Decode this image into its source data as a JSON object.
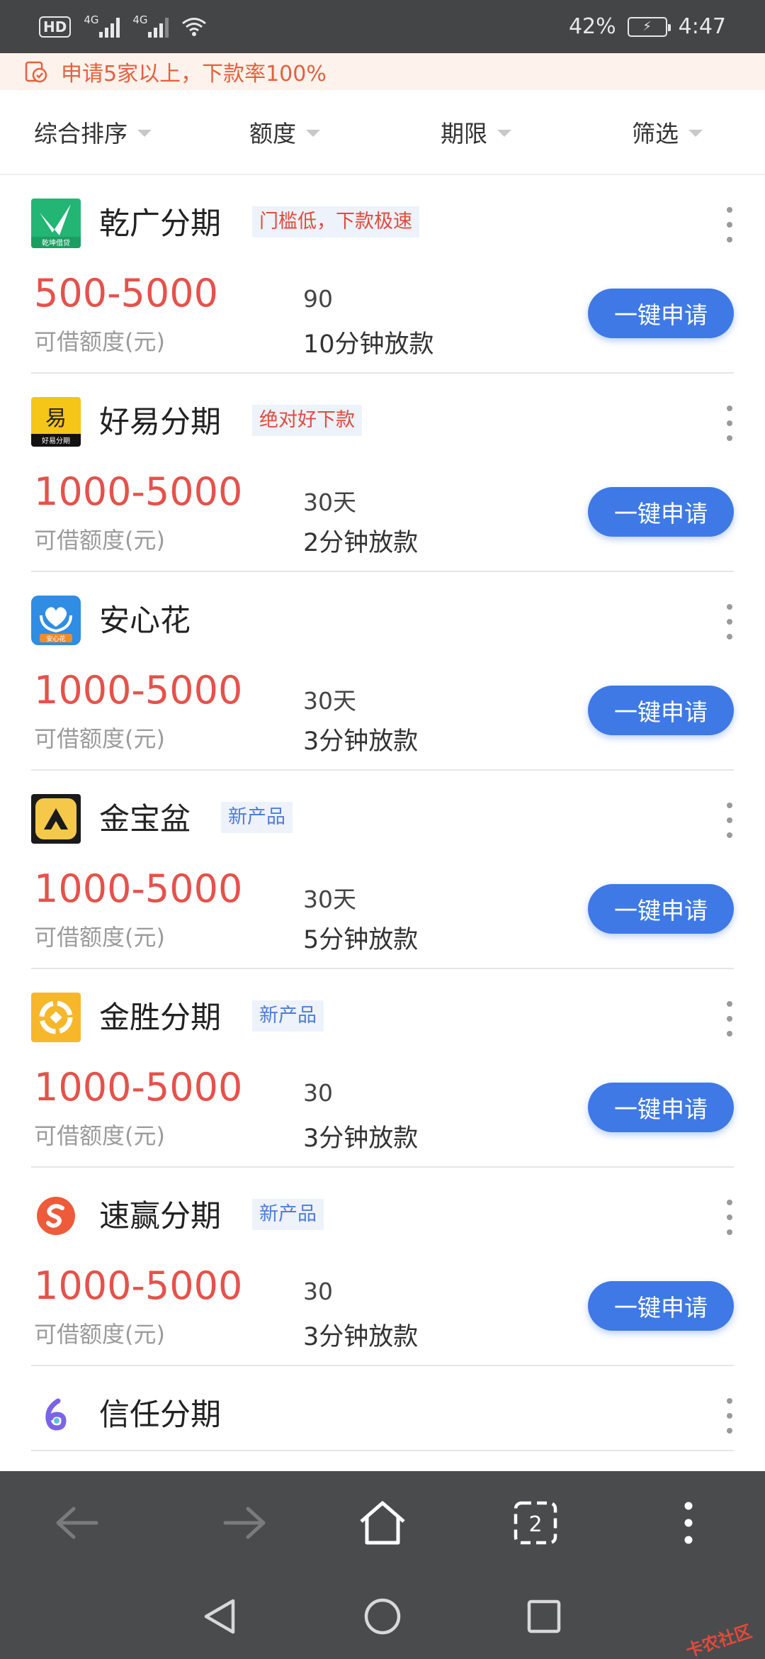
{
  "status_bar": {
    "hd": "HD",
    "sim1": "4G",
    "sim2": "4G",
    "battery": "42%",
    "time": "4:47"
  },
  "banner": {
    "text": "申请5家以上，下款率100%"
  },
  "filters": [
    {
      "label": "综合排序"
    },
    {
      "label": "额度"
    },
    {
      "label": "期限"
    },
    {
      "label": "筛选"
    }
  ],
  "products": [
    {
      "name": "乾广分期",
      "tag": "门槛低，下款极速",
      "tag_type": "red",
      "amount": "500-5000",
      "amount_label": "可借额度(元)",
      "term": "90",
      "speed": "10分钟放款",
      "apply_label": "一键申请",
      "logo_caption": "乾坤借贷"
    },
    {
      "name": "好易分期",
      "tag": "绝对好下款",
      "tag_type": "red",
      "amount": "1000-5000",
      "amount_label": "可借额度(元)",
      "term": "30天",
      "speed": "2分钟放款",
      "apply_label": "一键申请",
      "logo_caption": "好易分期",
      "logo_char": "易"
    },
    {
      "name": "安心花",
      "tag": "",
      "tag_type": "none",
      "amount": "1000-5000",
      "amount_label": "可借额度(元)",
      "term": "30天",
      "speed": "3分钟放款",
      "apply_label": "一键申请",
      "logo_caption": "安心花"
    },
    {
      "name": "金宝盆",
      "tag": "新产品",
      "tag_type": "blue",
      "amount": "1000-5000",
      "amount_label": "可借额度(元)",
      "term": "30天",
      "speed": "5分钟放款",
      "apply_label": "一键申请"
    },
    {
      "name": "金胜分期",
      "tag": "新产品",
      "tag_type": "blue",
      "amount": "1000-5000",
      "amount_label": "可借额度(元)",
      "term": "30",
      "speed": "3分钟放款",
      "apply_label": "一键申请"
    },
    {
      "name": "速赢分期",
      "tag": "新产品",
      "tag_type": "blue",
      "amount": "1000-5000",
      "amount_label": "可借额度(元)",
      "term": "30",
      "speed": "3分钟放款",
      "apply_label": "一键申请"
    },
    {
      "name": "信任分期",
      "tag": "",
      "tag_type": "none"
    }
  ],
  "toolbar": {
    "tab_count": "2"
  },
  "watermark": {
    "text": "卡农社区"
  },
  "colors": {
    "accent": "#3e79e6",
    "amount": "#e5524b",
    "banner_text": "#e5603f"
  }
}
